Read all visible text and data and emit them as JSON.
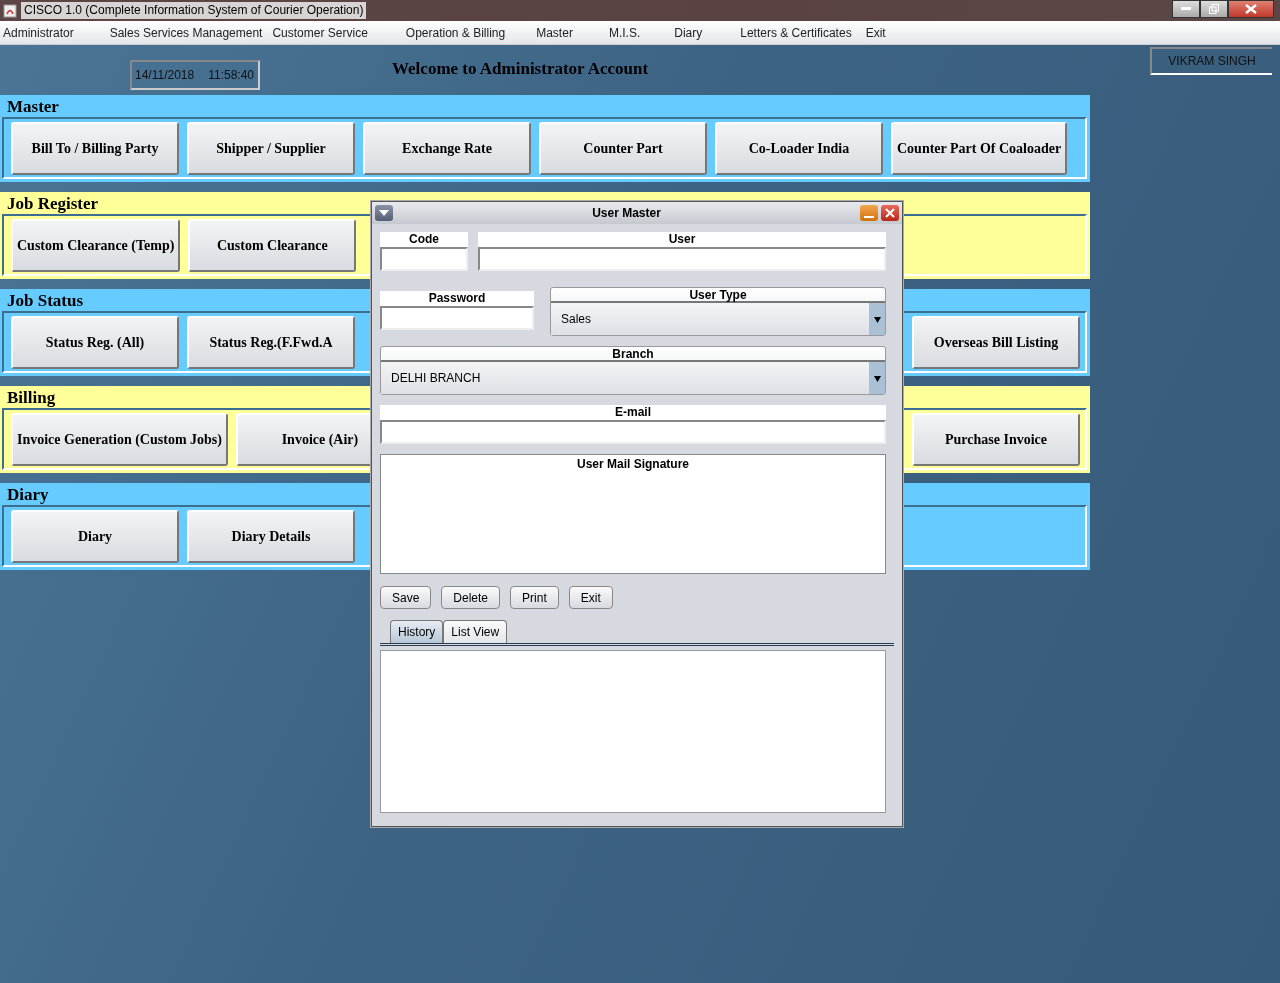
{
  "window": {
    "title": "CISCO 1.0 (Complete Information System of Courier Operation)"
  },
  "menu": [
    "Administrator",
    "Sales Services Management",
    "Customer Service",
    "Operation & Billing",
    "Master",
    "M.I.S.",
    "Diary",
    "Letters & Certificates",
    "Exit"
  ],
  "header": {
    "date": "14/11/2018",
    "time": "11:58:40",
    "welcome": "Welcome to Administrator Account",
    "user_name": "VIKRAM SINGH"
  },
  "sections": [
    {
      "title": "Master",
      "kind": "blue",
      "buttons": [
        "Bill To / Billing Party",
        "Shipper / Supplier",
        "Exchange Rate",
        "Counter Part",
        "Co-Loader India",
        "Counter Part Of Coaloader"
      ]
    },
    {
      "title": "Job Register",
      "kind": "yellow",
      "buttons": [
        "Custom Clearance (Temp)",
        "Custom Clearance"
      ]
    },
    {
      "title": "Job Status",
      "kind": "blue",
      "buttons": [
        "Status Reg. (All)",
        "Status Reg.(F.Fwd.A"
      ],
      "buttons_far": [
        "Overseas Bill Listing"
      ]
    },
    {
      "title": "Billing",
      "kind": "yellow",
      "buttons": [
        "Invoice Generation (Custom Jobs)",
        "Invoice (Air)"
      ],
      "buttons_far": [
        "Purchase Invoice"
      ]
    },
    {
      "title": "Diary",
      "kind": "blue",
      "buttons": [
        "Diary",
        "Diary Details"
      ]
    }
  ],
  "dialog": {
    "title": "User Master",
    "code_label": "Code",
    "user_label": "User",
    "password_label": "Password",
    "user_type": {
      "label": "User Type",
      "value": "Sales"
    },
    "branch": {
      "label": "Branch",
      "value": "DELHI BRANCH"
    },
    "email_label": "E-mail",
    "signature_label": "User Mail Signature",
    "buttons": [
      "Save",
      "Delete",
      "Print",
      "Exit"
    ],
    "tabs": [
      {
        "label": "History",
        "selected": true
      },
      {
        "label": "List View",
        "selected": false
      }
    ]
  }
}
